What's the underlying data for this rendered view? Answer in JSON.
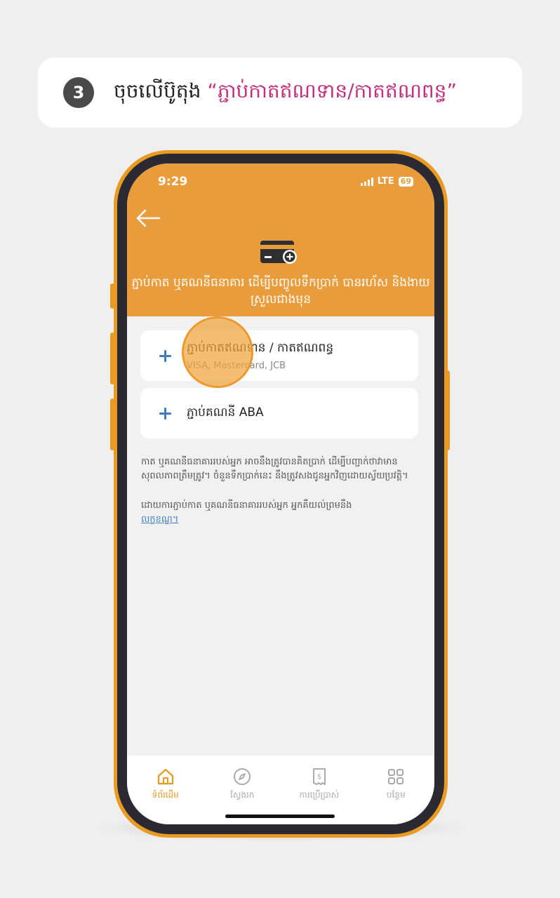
{
  "instruction": {
    "step_number": "3",
    "text": "ចុចលើប៊ូតុង",
    "highlight": "“ភ្ជាប់កាតឥណទាន/កាតឥណពន្ធ”",
    "highlight_color": "#c2307c"
  },
  "status_bar": {
    "time": "9:29",
    "network": "LTE",
    "battery": "69"
  },
  "header": {
    "back_icon": "arrow-left-icon",
    "card_icon": "card-add-icon",
    "text": "ភ្ជាប់កាត ឬគណនីធនាគារ ដើម្បីបញ្ចូលទឹកប្រាក់ បានរហ័ស និងងាយស្រួលជាងមុន",
    "background": "#e99c3b"
  },
  "options": [
    {
      "title": "ភ្ជាប់កាតឥណទាន / កាតឥណពន្ធ",
      "subtitle": "VISA, Mastercard, JCB"
    },
    {
      "title": "ភ្ជាប់គណនី ABA",
      "subtitle": ""
    }
  ],
  "info": {
    "paragraph1": "កាត ឬគណនីធនាគាររបស់អ្នក អាចនឹងត្រូវបានគិតប្រាក់ ដើម្បីបញ្ជាក់ថាវាមានសុពលភាពត្រឹមត្រូវ។ ចំនួនទឹកប្រាក់នេះ នឹងត្រូវសងជូនអ្នកវិញដោយស្វ័យប្រវត្តិ។",
    "paragraph2": "ដោយការភ្ជាប់កាត ឬគណនីធនាគាររបស់អ្នក អ្នកគឺយល់ព្រមនឹង",
    "link": "លក្ខខណ្ឌ។"
  },
  "tabbar": {
    "tabs": [
      {
        "label": "ទំព័រដើម",
        "icon": "home-icon",
        "active": true
      },
      {
        "label": "ស្វែងរក",
        "icon": "compass-icon",
        "active": false
      },
      {
        "label": "ការប្រើប្រាស់",
        "icon": "receipt-icon",
        "active": false
      },
      {
        "label": "បន្ថែម",
        "icon": "grid-icon",
        "active": false
      }
    ],
    "active_color": "#e89a23"
  }
}
